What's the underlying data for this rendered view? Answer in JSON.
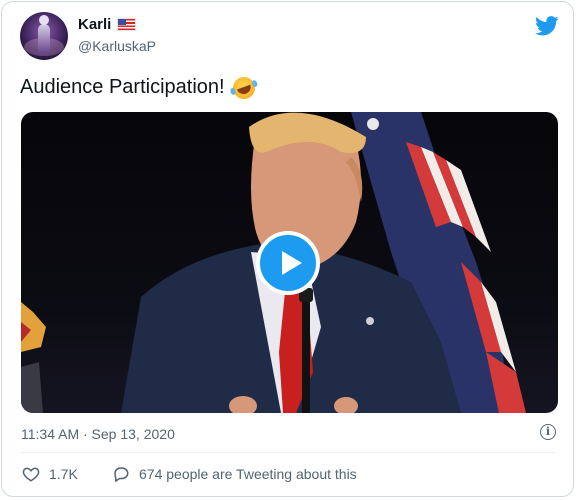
{
  "tweet": {
    "author_name": "Karli",
    "author_handle": "@KarluskaP",
    "text": "Audience Participation!",
    "timestamp": "11:34 AM · Sep 13, 2020"
  },
  "actions": {
    "likes_count": "1.7K",
    "reply_text": "674 people are Tweeting about this"
  },
  "colors": {
    "accent": "#1d9bf0",
    "secondary_text": "#536471"
  },
  "icons": {
    "brand": "twitter-bird-icon",
    "flag": "us-flag-icon",
    "emoji": "rolling-on-floor-laughing-icon",
    "play": "play-icon",
    "info": "info-icon",
    "like": "heart-icon",
    "reply": "speech-bubble-icon"
  }
}
